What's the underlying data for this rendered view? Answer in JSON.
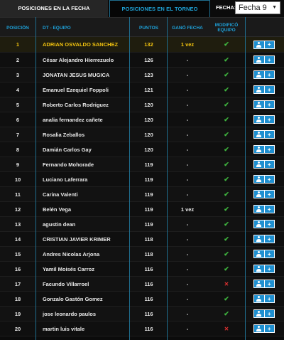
{
  "tabs": {
    "fecha": "POSICIONES EN LA FECHA",
    "torneo": "POSICIONES EN EL TORNEO"
  },
  "fecha_filter": {
    "label": "FECHA:",
    "selected": "Fecha 9"
  },
  "headers": {
    "posicion": "POSICIÓN",
    "equipo": "DT - EQUIPO",
    "puntos": "PUNTOS",
    "gano_fecha": "GANÓ FECHA",
    "modifico": "MODIFICÓ EQUIPO"
  },
  "colors": {
    "accent": "#1ea0d8",
    "leader": "#f2c30f",
    "check": "#3fb53f",
    "cross": "#e03131",
    "button": "#1e8fd0"
  },
  "rows": [
    {
      "pos": "1",
      "name": "ADRIAN OSVALDO SANCHEZ",
      "pts": "132",
      "gano": "1 vez",
      "mod": "check-icon"
    },
    {
      "pos": "2",
      "name": "César Alejandro Hierrezuelo",
      "pts": "126",
      "gano": "-",
      "mod": "check-icon"
    },
    {
      "pos": "3",
      "name": "JONATAN JESUS MUGICA",
      "pts": "123",
      "gano": "-",
      "mod": "check-icon"
    },
    {
      "pos": "4",
      "name": "Emanuel Ezequiel Foppoli",
      "pts": "121",
      "gano": "-",
      "mod": "check-icon"
    },
    {
      "pos": "5",
      "name": "Roberto Carlos Rodriguez",
      "pts": "120",
      "gano": "-",
      "mod": "check-icon"
    },
    {
      "pos": "6",
      "name": "analia fernandez cañete",
      "pts": "120",
      "gano": "-",
      "mod": "check-icon"
    },
    {
      "pos": "7",
      "name": "Rosalia Zeballos",
      "pts": "120",
      "gano": "-",
      "mod": "check-icon"
    },
    {
      "pos": "8",
      "name": "Damián Carlos Gay",
      "pts": "120",
      "gano": "-",
      "mod": "check-icon"
    },
    {
      "pos": "9",
      "name": "Fernando Mohorade",
      "pts": "119",
      "gano": "-",
      "mod": "check-icon"
    },
    {
      "pos": "10",
      "name": "Luciano Laferrara",
      "pts": "119",
      "gano": "-",
      "mod": "check-icon"
    },
    {
      "pos": "11",
      "name": "Carina Valenti",
      "pts": "119",
      "gano": "-",
      "mod": "check-icon"
    },
    {
      "pos": "12",
      "name": "Belén Vega",
      "pts": "119",
      "gano": "1 vez",
      "mod": "check-icon"
    },
    {
      "pos": "13",
      "name": "agustin dean",
      "pts": "119",
      "gano": "-",
      "mod": "check-icon"
    },
    {
      "pos": "14",
      "name": "CRISTIAN JAVIER KRIMER",
      "pts": "118",
      "gano": "-",
      "mod": "check-icon"
    },
    {
      "pos": "15",
      "name": "Andres Nicolas Arjona",
      "pts": "118",
      "gano": "-",
      "mod": "check-icon"
    },
    {
      "pos": "16",
      "name": "Yamil Moisés Carroz",
      "pts": "116",
      "gano": "-",
      "mod": "check-icon"
    },
    {
      "pos": "17",
      "name": "Facundo Villarroel",
      "pts": "116",
      "gano": "-",
      "mod": "cross-icon"
    },
    {
      "pos": "18",
      "name": "Gonzalo Gastón Gomez",
      "pts": "116",
      "gano": "-",
      "mod": "check-icon"
    },
    {
      "pos": "19",
      "name": "jose leonardo paulos",
      "pts": "116",
      "gano": "-",
      "mod": "check-icon"
    },
    {
      "pos": "20",
      "name": "martin luis vitale",
      "pts": "116",
      "gano": "-",
      "mod": "cross-icon"
    }
  ]
}
